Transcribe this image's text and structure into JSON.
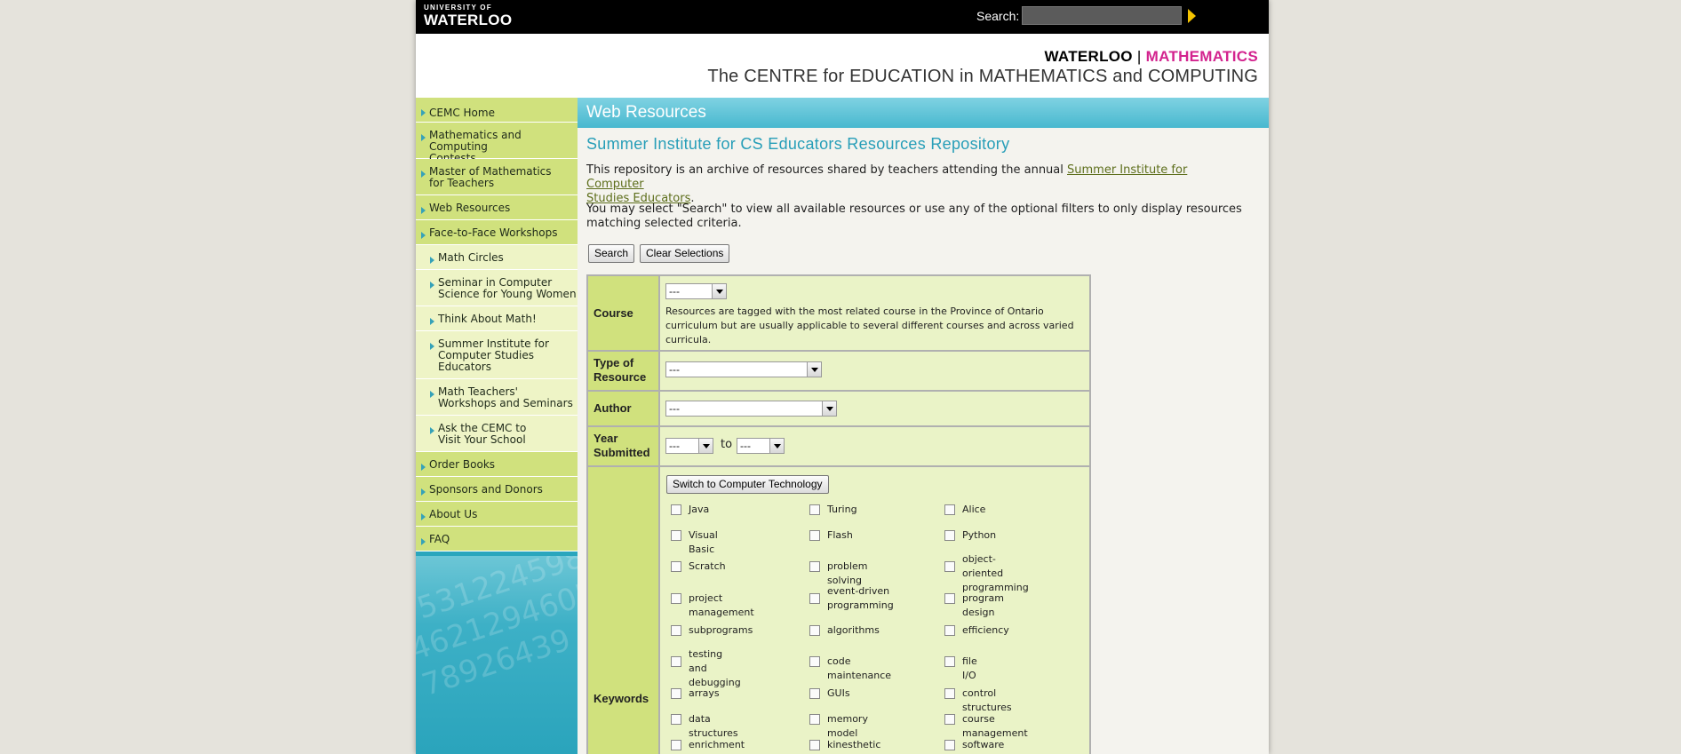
{
  "topbar": {
    "logo_line1": "UNIVERSITY OF",
    "logo_line2": "WATERLOO",
    "search_label": "Search:",
    "search_value": ""
  },
  "header": {
    "brand_waterloo": "WATERLOO",
    "brand_sep": "|",
    "brand_math": "MATHEMATICS",
    "centre": "The CENTRE for EDUCATION in MATHEMATICS and COMPUTING"
  },
  "sidebar": {
    "items": [
      {
        "line1": "CEMC Home",
        "line2": ""
      },
      {
        "line1": "Mathematics and Computing",
        "line2": "Contests"
      },
      {
        "line1": "Master of Mathematics",
        "line2": "for Teachers"
      },
      {
        "line1": "Web Resources",
        "line2": ""
      },
      {
        "line1": "Face-to-Face Workshops",
        "line2": ""
      },
      {
        "line1": "Math Circles",
        "line2": ""
      },
      {
        "line1": "Seminar in Computer",
        "line2": "Science for Young Women"
      },
      {
        "line1": "Think About Math!",
        "line2": ""
      },
      {
        "line1": "Summer Institute for",
        "line2": "Computer Studies",
        "line3": "Educators"
      },
      {
        "line1": "Math Teachers'",
        "line2": "Workshops and Seminars"
      },
      {
        "line1": "Ask the CEMC to",
        "line2": "Visit Your School"
      },
      {
        "line1": "Order Books",
        "line2": ""
      },
      {
        "line1": "Sponsors and Donors",
        "line2": ""
      },
      {
        "line1": "About Us",
        "line2": ""
      },
      {
        "line1": "FAQ",
        "line2": ""
      }
    ]
  },
  "main": {
    "section_title": "Web Resources",
    "heading": "Summer Institute for CS Educators Resources Repository",
    "intro_before": "This repository is an archive of resources shared by teachers attending the annual ",
    "intro_link_1": "Summer Institute for Computer",
    "intro_link_2": "Studies Educators",
    "intro_after": ".",
    "instructions_1": "You may select \"Search\" to view all available resources or use any of the optional filters to only display resources",
    "instructions_2": "matching selected criteria.",
    "search_button": "Search",
    "clear_button": "Clear Selections"
  },
  "filters": {
    "course_label": "Course",
    "course_value": "---",
    "course_note_1": "Resources are tagged with the most related course in the Province of Ontario",
    "course_note_2": "curriculum but are usually applicable to several different courses and across varied",
    "course_note_3": "curricula.",
    "type_label_1": "Type of",
    "type_label_2": "Resource",
    "type_value": "---",
    "author_label": "Author",
    "author_value": "---",
    "year_label_1": "Year",
    "year_label_2": "Submitted",
    "year_from": "---",
    "year_to_label": "to",
    "year_to": "---",
    "keywords_label": "Keywords",
    "switch_button": "Switch to Computer Technology",
    "keywords": [
      [
        "Java",
        "Turing",
        "Alice"
      ],
      [
        "Visual Basic",
        "Flash",
        "Python"
      ],
      [
        "Scratch",
        "problem solving",
        "object-oriented|programming"
      ],
      [
        "project management",
        "event-driven|programming",
        "program design"
      ],
      [
        "subprograms",
        "algorithms",
        "efficiency"
      ],
      [
        "testing and|debugging",
        "code maintenance",
        "file I/O"
      ],
      [
        "arrays",
        "GUIs",
        "control structures"
      ],
      [
        "data structures",
        "memory model",
        "course management"
      ],
      [
        "enrichment",
        "kinesthetic learning",
        "software applications"
      ]
    ]
  }
}
